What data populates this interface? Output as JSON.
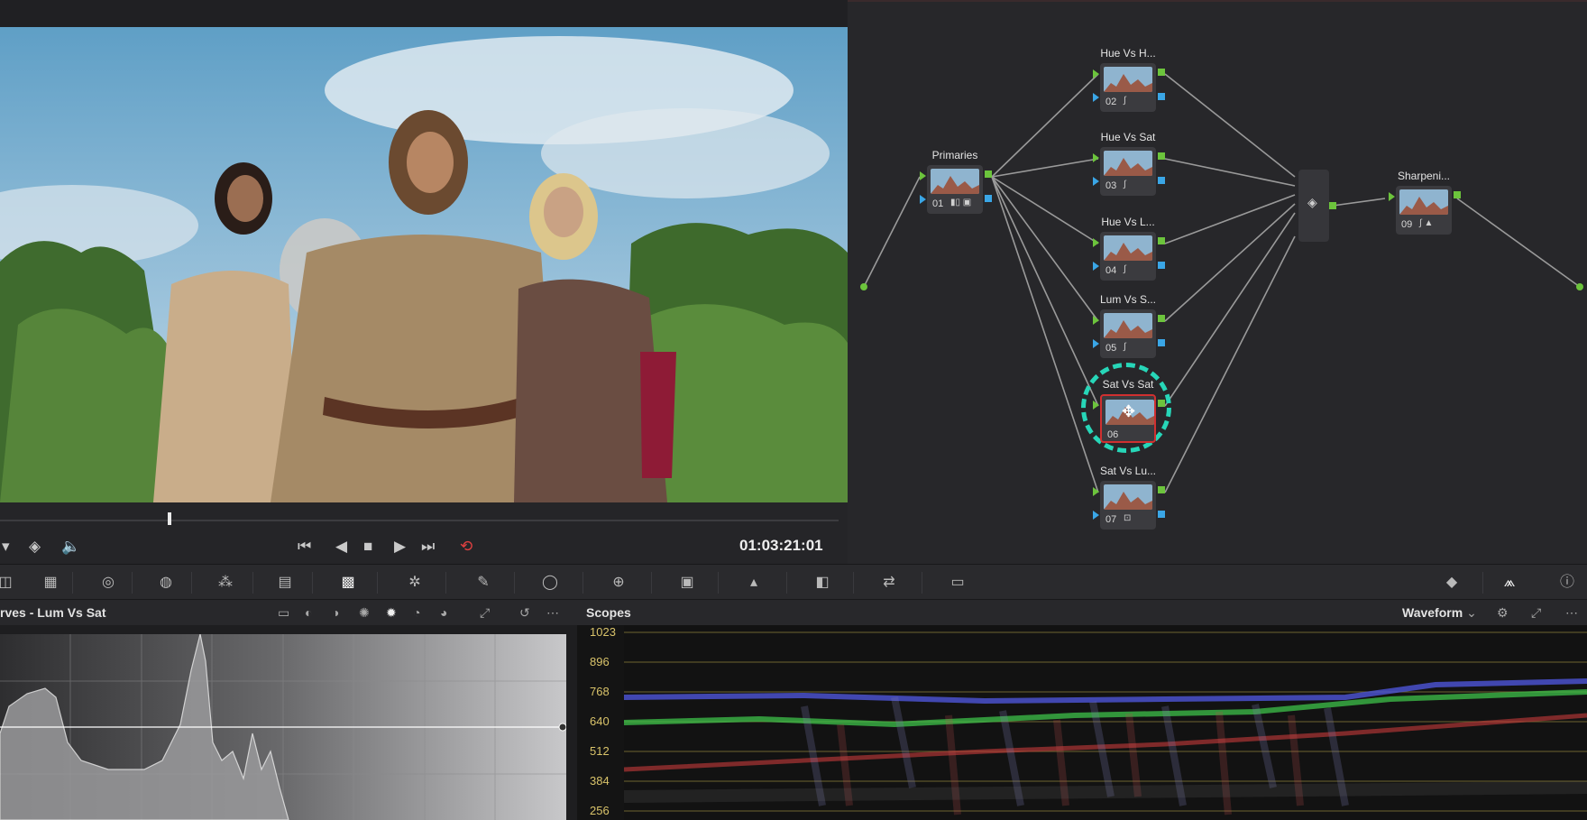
{
  "transport": {
    "timecode": "01:03:21:01",
    "buttons": [
      "skip-to-start",
      "step-back",
      "stop",
      "play",
      "skip-to-end",
      "loop"
    ],
    "playhead_fraction": 0.2
  },
  "nodes": {
    "primaries": {
      "label": "Primaries",
      "id": "01"
    },
    "hue_vs_hue": {
      "label": "Hue Vs H...",
      "id": "02"
    },
    "hue_vs_sat": {
      "label": "Hue Vs Sat",
      "id": "03"
    },
    "hue_vs_lum": {
      "label": "Hue Vs L...",
      "id": "04"
    },
    "lum_vs_sat": {
      "label": "Lum Vs S...",
      "id": "05"
    },
    "sat_vs_sat": {
      "label": "Sat Vs Sat",
      "id": "06"
    },
    "sat_vs_lum": {
      "label": "Sat Vs Lu...",
      "id": "07"
    },
    "sharpening": {
      "label": "Sharpeni...",
      "id": "09"
    }
  },
  "curves": {
    "title": "rves - Lum Vs Sat"
  },
  "scopes": {
    "title": "Scopes",
    "mode": "Waveform",
    "levels": [
      "1023",
      "896",
      "768",
      "640",
      "512",
      "384",
      "256"
    ]
  },
  "colors": {
    "accent_green": "#6cc43c",
    "accent_blue": "#3aa6e6",
    "selection_ring": "#27d6b8",
    "loop_active": "#e04040",
    "scope_label": "#d9c36a"
  }
}
